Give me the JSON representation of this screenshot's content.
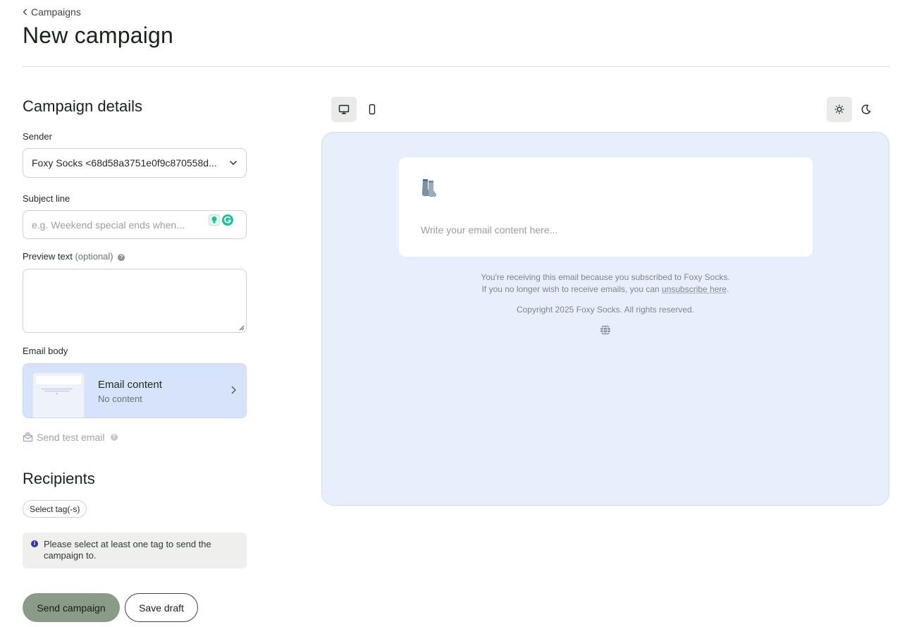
{
  "breadcrumb": {
    "label": "Campaigns"
  },
  "page": {
    "title": "New campaign"
  },
  "details": {
    "section_title": "Campaign details",
    "sender": {
      "label": "Sender",
      "value": "Foxy Socks <68d58a3751e0f9c870558d..."
    },
    "subject": {
      "label": "Subject line",
      "placeholder": "e.g. Weekend special ends when..."
    },
    "preview_text": {
      "label": "Preview text",
      "optional": "(optional)"
    },
    "email_body": {
      "label": "Email body",
      "card_title": "Email content",
      "card_sub": "No content"
    },
    "send_test": {
      "label": "Send test email"
    }
  },
  "recipients": {
    "section_title": "Recipients",
    "tag_button": "Select tag(-s)",
    "notice": "Please select at least one tag to send the campaign to."
  },
  "actions": {
    "send": "Send campaign",
    "save": "Save draft"
  },
  "preview": {
    "content_placeholder": "Write your email content here...",
    "footer_line1": "You're receiving this email because you subscribed to Foxy Socks.",
    "footer_line2_prefix": "If you no longer wish to receive emails, you can ",
    "footer_link": "unsubscribe here",
    "footer_line2_suffix": ".",
    "copyright": "Copyright 2025 Foxy Socks. All rights reserved."
  },
  "colors": {
    "primary_button": "#8a9b88",
    "preview_bg": "#e8effc",
    "email_card_bg": "#d6e3fb",
    "info_icon": "#2b3aa0"
  },
  "icons": [
    "chevron-left-icon",
    "chevron-down-icon",
    "help-icon",
    "email-stack-icon",
    "chevron-right-icon",
    "info-icon",
    "desktop-icon",
    "mobile-icon",
    "sun-icon",
    "moon-icon",
    "sock-icon",
    "globe-icon"
  ]
}
